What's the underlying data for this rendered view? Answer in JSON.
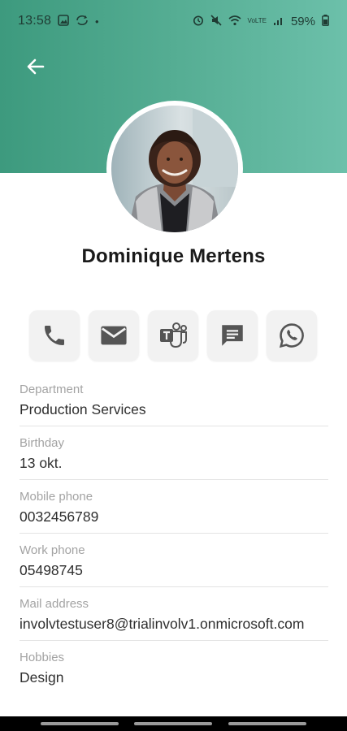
{
  "status_bar": {
    "time": "13:58",
    "battery": "59%",
    "left_icons": [
      "gallery-icon",
      "sync-icon",
      "dot-icon"
    ],
    "right_icons": [
      "alarm-icon",
      "mute-icon",
      "wifi-icon",
      "lte-icon",
      "signal-icon",
      "battery-icon"
    ],
    "lte_label": "VoLTE"
  },
  "header": {
    "accent_color": "#4fa98d",
    "back_icon": "arrow-left-icon"
  },
  "profile": {
    "name": "Dominique Mertens",
    "avatar_icon": "profile-photo"
  },
  "actions": [
    {
      "name": "call",
      "icon": "phone-icon"
    },
    {
      "name": "email",
      "icon": "mail-icon"
    },
    {
      "name": "teams",
      "icon": "teams-icon"
    },
    {
      "name": "message",
      "icon": "chat-icon"
    },
    {
      "name": "whatsapp",
      "icon": "whatsapp-icon"
    }
  ],
  "fields": [
    {
      "label": "Department",
      "value": "Production Services"
    },
    {
      "label": "Birthday",
      "value": "13 okt."
    },
    {
      "label": "Mobile phone",
      "value": "0032456789"
    },
    {
      "label": "Work phone",
      "value": "05498745"
    },
    {
      "label": "Mail address",
      "value": "involvtestuser8@trialinvolv1.onmicrosoft.com"
    },
    {
      "label": "Hobbies",
      "value": "Design"
    }
  ]
}
